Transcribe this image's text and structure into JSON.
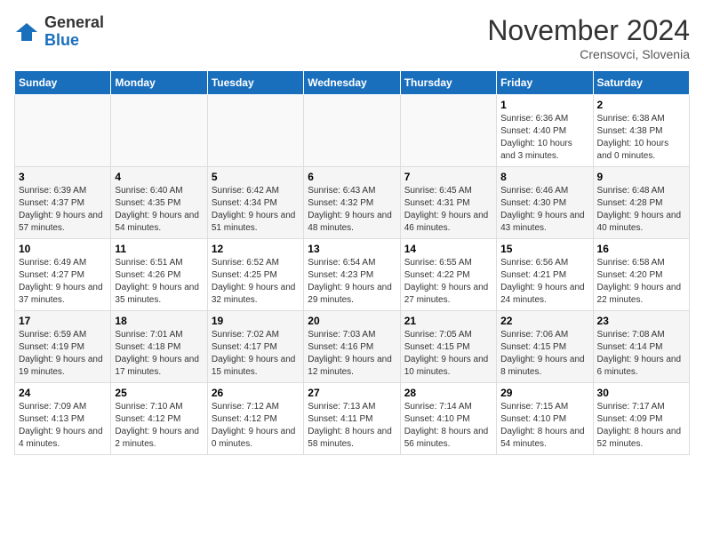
{
  "logo": {
    "general": "General",
    "blue": "Blue"
  },
  "title": "November 2024",
  "location": "Crensovci, Slovenia",
  "days_of_week": [
    "Sunday",
    "Monday",
    "Tuesday",
    "Wednesday",
    "Thursday",
    "Friday",
    "Saturday"
  ],
  "weeks": [
    {
      "shaded": false,
      "days": [
        {
          "num": "",
          "empty": true
        },
        {
          "num": "",
          "empty": true
        },
        {
          "num": "",
          "empty": true
        },
        {
          "num": "",
          "empty": true
        },
        {
          "num": "",
          "empty": true
        },
        {
          "num": "1",
          "sunrise": "Sunrise: 6:36 AM",
          "sunset": "Sunset: 4:40 PM",
          "daylight": "Daylight: 10 hours and 3 minutes."
        },
        {
          "num": "2",
          "sunrise": "Sunrise: 6:38 AM",
          "sunset": "Sunset: 4:38 PM",
          "daylight": "Daylight: 10 hours and 0 minutes."
        }
      ]
    },
    {
      "shaded": true,
      "days": [
        {
          "num": "3",
          "sunrise": "Sunrise: 6:39 AM",
          "sunset": "Sunset: 4:37 PM",
          "daylight": "Daylight: 9 hours and 57 minutes."
        },
        {
          "num": "4",
          "sunrise": "Sunrise: 6:40 AM",
          "sunset": "Sunset: 4:35 PM",
          "daylight": "Daylight: 9 hours and 54 minutes."
        },
        {
          "num": "5",
          "sunrise": "Sunrise: 6:42 AM",
          "sunset": "Sunset: 4:34 PM",
          "daylight": "Daylight: 9 hours and 51 minutes."
        },
        {
          "num": "6",
          "sunrise": "Sunrise: 6:43 AM",
          "sunset": "Sunset: 4:32 PM",
          "daylight": "Daylight: 9 hours and 48 minutes."
        },
        {
          "num": "7",
          "sunrise": "Sunrise: 6:45 AM",
          "sunset": "Sunset: 4:31 PM",
          "daylight": "Daylight: 9 hours and 46 minutes."
        },
        {
          "num": "8",
          "sunrise": "Sunrise: 6:46 AM",
          "sunset": "Sunset: 4:30 PM",
          "daylight": "Daylight: 9 hours and 43 minutes."
        },
        {
          "num": "9",
          "sunrise": "Sunrise: 6:48 AM",
          "sunset": "Sunset: 4:28 PM",
          "daylight": "Daylight: 9 hours and 40 minutes."
        }
      ]
    },
    {
      "shaded": false,
      "days": [
        {
          "num": "10",
          "sunrise": "Sunrise: 6:49 AM",
          "sunset": "Sunset: 4:27 PM",
          "daylight": "Daylight: 9 hours and 37 minutes."
        },
        {
          "num": "11",
          "sunrise": "Sunrise: 6:51 AM",
          "sunset": "Sunset: 4:26 PM",
          "daylight": "Daylight: 9 hours and 35 minutes."
        },
        {
          "num": "12",
          "sunrise": "Sunrise: 6:52 AM",
          "sunset": "Sunset: 4:25 PM",
          "daylight": "Daylight: 9 hours and 32 minutes."
        },
        {
          "num": "13",
          "sunrise": "Sunrise: 6:54 AM",
          "sunset": "Sunset: 4:23 PM",
          "daylight": "Daylight: 9 hours and 29 minutes."
        },
        {
          "num": "14",
          "sunrise": "Sunrise: 6:55 AM",
          "sunset": "Sunset: 4:22 PM",
          "daylight": "Daylight: 9 hours and 27 minutes."
        },
        {
          "num": "15",
          "sunrise": "Sunrise: 6:56 AM",
          "sunset": "Sunset: 4:21 PM",
          "daylight": "Daylight: 9 hours and 24 minutes."
        },
        {
          "num": "16",
          "sunrise": "Sunrise: 6:58 AM",
          "sunset": "Sunset: 4:20 PM",
          "daylight": "Daylight: 9 hours and 22 minutes."
        }
      ]
    },
    {
      "shaded": true,
      "days": [
        {
          "num": "17",
          "sunrise": "Sunrise: 6:59 AM",
          "sunset": "Sunset: 4:19 PM",
          "daylight": "Daylight: 9 hours and 19 minutes."
        },
        {
          "num": "18",
          "sunrise": "Sunrise: 7:01 AM",
          "sunset": "Sunset: 4:18 PM",
          "daylight": "Daylight: 9 hours and 17 minutes."
        },
        {
          "num": "19",
          "sunrise": "Sunrise: 7:02 AM",
          "sunset": "Sunset: 4:17 PM",
          "daylight": "Daylight: 9 hours and 15 minutes."
        },
        {
          "num": "20",
          "sunrise": "Sunrise: 7:03 AM",
          "sunset": "Sunset: 4:16 PM",
          "daylight": "Daylight: 9 hours and 12 minutes."
        },
        {
          "num": "21",
          "sunrise": "Sunrise: 7:05 AM",
          "sunset": "Sunset: 4:15 PM",
          "daylight": "Daylight: 9 hours and 10 minutes."
        },
        {
          "num": "22",
          "sunrise": "Sunrise: 7:06 AM",
          "sunset": "Sunset: 4:15 PM",
          "daylight": "Daylight: 9 hours and 8 minutes."
        },
        {
          "num": "23",
          "sunrise": "Sunrise: 7:08 AM",
          "sunset": "Sunset: 4:14 PM",
          "daylight": "Daylight: 9 hours and 6 minutes."
        }
      ]
    },
    {
      "shaded": false,
      "days": [
        {
          "num": "24",
          "sunrise": "Sunrise: 7:09 AM",
          "sunset": "Sunset: 4:13 PM",
          "daylight": "Daylight: 9 hours and 4 minutes."
        },
        {
          "num": "25",
          "sunrise": "Sunrise: 7:10 AM",
          "sunset": "Sunset: 4:12 PM",
          "daylight": "Daylight: 9 hours and 2 minutes."
        },
        {
          "num": "26",
          "sunrise": "Sunrise: 7:12 AM",
          "sunset": "Sunset: 4:12 PM",
          "daylight": "Daylight: 9 hours and 0 minutes."
        },
        {
          "num": "27",
          "sunrise": "Sunrise: 7:13 AM",
          "sunset": "Sunset: 4:11 PM",
          "daylight": "Daylight: 8 hours and 58 minutes."
        },
        {
          "num": "28",
          "sunrise": "Sunrise: 7:14 AM",
          "sunset": "Sunset: 4:10 PM",
          "daylight": "Daylight: 8 hours and 56 minutes."
        },
        {
          "num": "29",
          "sunrise": "Sunrise: 7:15 AM",
          "sunset": "Sunset: 4:10 PM",
          "daylight": "Daylight: 8 hours and 54 minutes."
        },
        {
          "num": "30",
          "sunrise": "Sunrise: 7:17 AM",
          "sunset": "Sunset: 4:09 PM",
          "daylight": "Daylight: 8 hours and 52 minutes."
        }
      ]
    }
  ]
}
